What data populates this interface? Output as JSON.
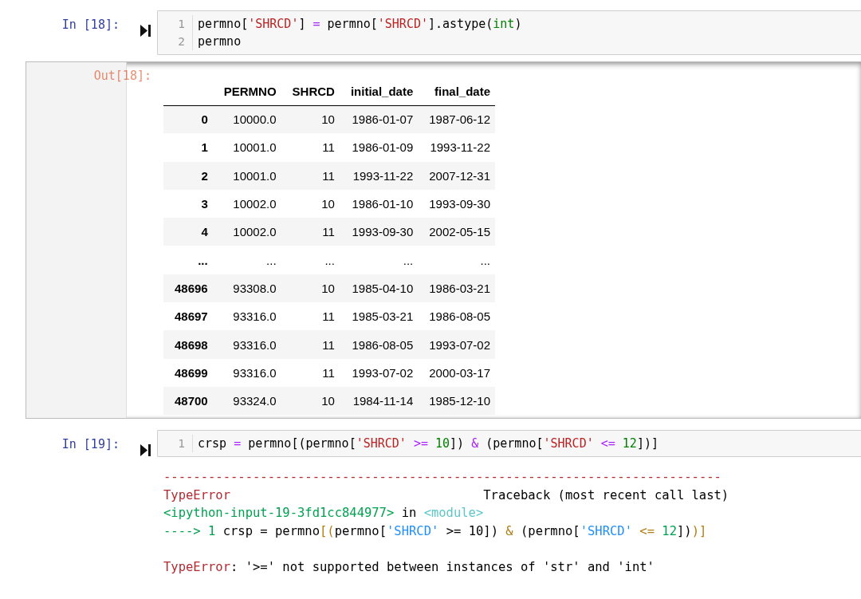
{
  "cell_18": {
    "prompt": "In [18]:",
    "code_lines": [
      {
        "number": "1",
        "tokens": [
          {
            "kind": "plain",
            "text": "permno["
          },
          {
            "kind": "string",
            "text": "'SHRCD'"
          },
          {
            "kind": "plain",
            "text": "] "
          },
          {
            "kind": "operator",
            "text": "="
          },
          {
            "kind": "plain",
            "text": " permno["
          },
          {
            "kind": "string",
            "text": "'SHRCD'"
          },
          {
            "kind": "plain",
            "text": "].astype("
          },
          {
            "kind": "builtin",
            "text": "int"
          },
          {
            "kind": "plain",
            "text": ")"
          }
        ]
      },
      {
        "number": "2",
        "tokens": [
          {
            "kind": "plain",
            "text": "permno"
          }
        ]
      }
    ]
  },
  "output_18": {
    "prompt": "Out[18]:",
    "table": {
      "columns": [
        "PERMNO",
        "SHRCD",
        "initial_date",
        "final_date"
      ],
      "rows": [
        {
          "index": "0",
          "cells": [
            "10000.0",
            "10",
            "1986-01-07",
            "1987-06-12"
          ]
        },
        {
          "index": "1",
          "cells": [
            "10001.0",
            "11",
            "1986-01-09",
            "1993-11-22"
          ]
        },
        {
          "index": "2",
          "cells": [
            "10001.0",
            "11",
            "1993-11-22",
            "2007-12-31"
          ]
        },
        {
          "index": "3",
          "cells": [
            "10002.0",
            "10",
            "1986-01-10",
            "1993-09-30"
          ]
        },
        {
          "index": "4",
          "cells": [
            "10002.0",
            "11",
            "1993-09-30",
            "2002-05-15"
          ]
        },
        {
          "index": "...",
          "cells": [
            "...",
            "...",
            "...",
            "..."
          ]
        },
        {
          "index": "48696",
          "cells": [
            "93308.0",
            "10",
            "1985-04-10",
            "1986-03-21"
          ]
        },
        {
          "index": "48697",
          "cells": [
            "93316.0",
            "11",
            "1985-03-21",
            "1986-08-05"
          ]
        },
        {
          "index": "48698",
          "cells": [
            "93316.0",
            "11",
            "1986-08-05",
            "1993-07-02"
          ]
        },
        {
          "index": "48699",
          "cells": [
            "93316.0",
            "11",
            "1993-07-02",
            "2000-03-17"
          ]
        },
        {
          "index": "48700",
          "cells": [
            "93324.0",
            "10",
            "1984-11-14",
            "1985-12-10"
          ]
        }
      ]
    }
  },
  "cell_19": {
    "prompt": "In [19]:",
    "code_lines": [
      {
        "number": "1",
        "tokens": [
          {
            "kind": "plain",
            "text": "crsp "
          },
          {
            "kind": "operator",
            "text": "="
          },
          {
            "kind": "plain",
            "text": " permno[(permno["
          },
          {
            "kind": "string",
            "text": "'SHRCD'"
          },
          {
            "kind": "operator",
            "text": " >= "
          },
          {
            "kind": "number",
            "text": "10"
          },
          {
            "kind": "plain",
            "text": "]) "
          },
          {
            "kind": "operator",
            "text": "&"
          },
          {
            "kind": "plain",
            "text": " (permno["
          },
          {
            "kind": "string",
            "text": "'SHRCD'"
          },
          {
            "kind": "operator",
            "text": " <= "
          },
          {
            "kind": "number",
            "text": "12"
          },
          {
            "kind": "plain",
            "text": "])]"
          }
        ]
      }
    ]
  },
  "error_output": {
    "separator": "---------------------------------------------------------------------------",
    "lines": [
      {
        "kind": "header",
        "tokens": [
          {
            "kind": "error",
            "text": "TypeError"
          },
          {
            "kind": "plain",
            "text": "Traceback (most recent call last)"
          }
        ]
      },
      {
        "kind": "normal",
        "tokens": [
          {
            "kind": "file",
            "text": "<ipython-input-19-3fd1cc844977>"
          },
          {
            "kind": "plain",
            "text": " in "
          },
          {
            "kind": "module",
            "text": "<module>"
          }
        ]
      },
      {
        "kind": "normal",
        "tokens": [
          {
            "kind": "arrow",
            "text": "----> 1"
          },
          {
            "kind": "plain",
            "text": " crsp = permno"
          },
          {
            "kind": "bracket",
            "text": "[("
          },
          {
            "kind": "plain",
            "text": "permno["
          },
          {
            "kind": "tstring",
            "text": "'SHRCD'"
          },
          {
            "kind": "plain",
            "text": " >= "
          },
          {
            "kind": "plain",
            "text": "10]) "
          },
          {
            "kind": "bracket",
            "text": "&"
          },
          {
            "kind": "plain",
            "text": " (permno["
          },
          {
            "kind": "tstring",
            "text": "'SHRCD'"
          },
          {
            "kind": "bracket",
            "text": " <= "
          },
          {
            "kind": "tnumber",
            "text": "12"
          },
          {
            "kind": "plain",
            "text": "])"
          },
          {
            "kind": "bracket",
            "text": ")]"
          }
        ]
      },
      {
        "kind": "blank"
      },
      {
        "kind": "normal",
        "tokens": [
          {
            "kind": "error",
            "text": "TypeError"
          },
          {
            "kind": "plain",
            "text": ": '>=' not supported between instances of 'str' and 'int'"
          }
        ]
      }
    ]
  }
}
